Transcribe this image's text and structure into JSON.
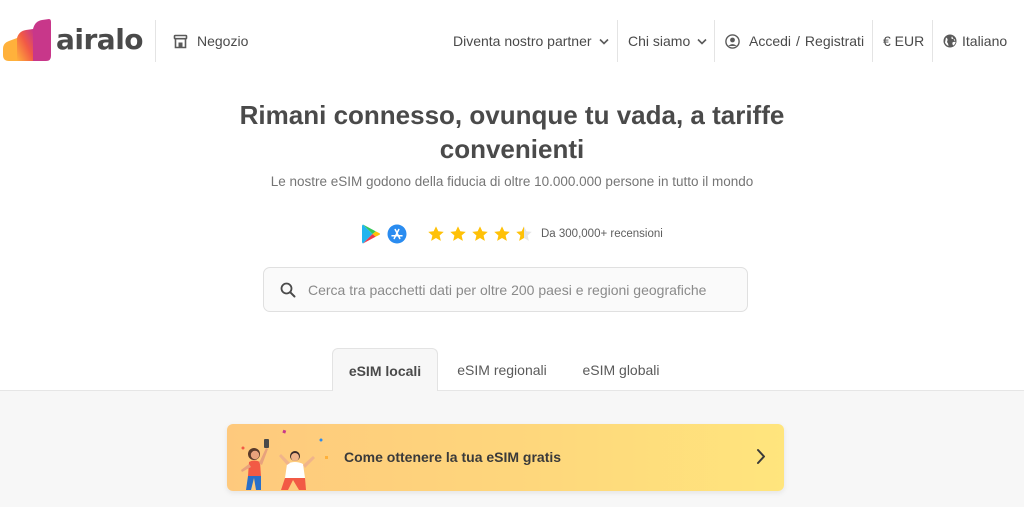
{
  "brand": {
    "name": "airalo",
    "colors": {
      "logo_gradient": [
        "#ffb13b",
        "#f25a45",
        "#c8378a"
      ],
      "star": "#ffc107",
      "promo_start": "#fec97d",
      "promo_end": "#ffe57d"
    }
  },
  "header": {
    "shop_label": "Negozio",
    "shop_icon": "store-icon",
    "partner_label": "Diventa nostro partner",
    "about_label": "Chi siamo",
    "login_label": "Accedi",
    "login_separator": "/",
    "register_label": "Registrati",
    "account_icon": "user-circle-icon",
    "currency_label": "€ EUR",
    "language_label": "Italiano",
    "language_icon": "globe-icon"
  },
  "hero": {
    "title": "Rimani connesso, ovunque tu vada, a tariffe convenienti",
    "subtitle": "Le nostre eSIM godono della fiducia di oltre 10.000.000 persone in tutto il mondo",
    "rating_value": 4.5,
    "rating_max": 5,
    "reviews_label": "Da 300,000+ recensioni",
    "store_icons": [
      "google-play-icon",
      "app-store-icon"
    ]
  },
  "search": {
    "placeholder": "Cerca tra pacchetti dati per oltre 200 paesi e regioni geografiche",
    "value": ""
  },
  "tabs": [
    {
      "label": "eSIM locali",
      "active": true
    },
    {
      "label": "eSIM regionali",
      "active": false
    },
    {
      "label": "eSIM globali",
      "active": false
    }
  ],
  "promo": {
    "label": "Come ottenere la tua eSIM gratis"
  }
}
